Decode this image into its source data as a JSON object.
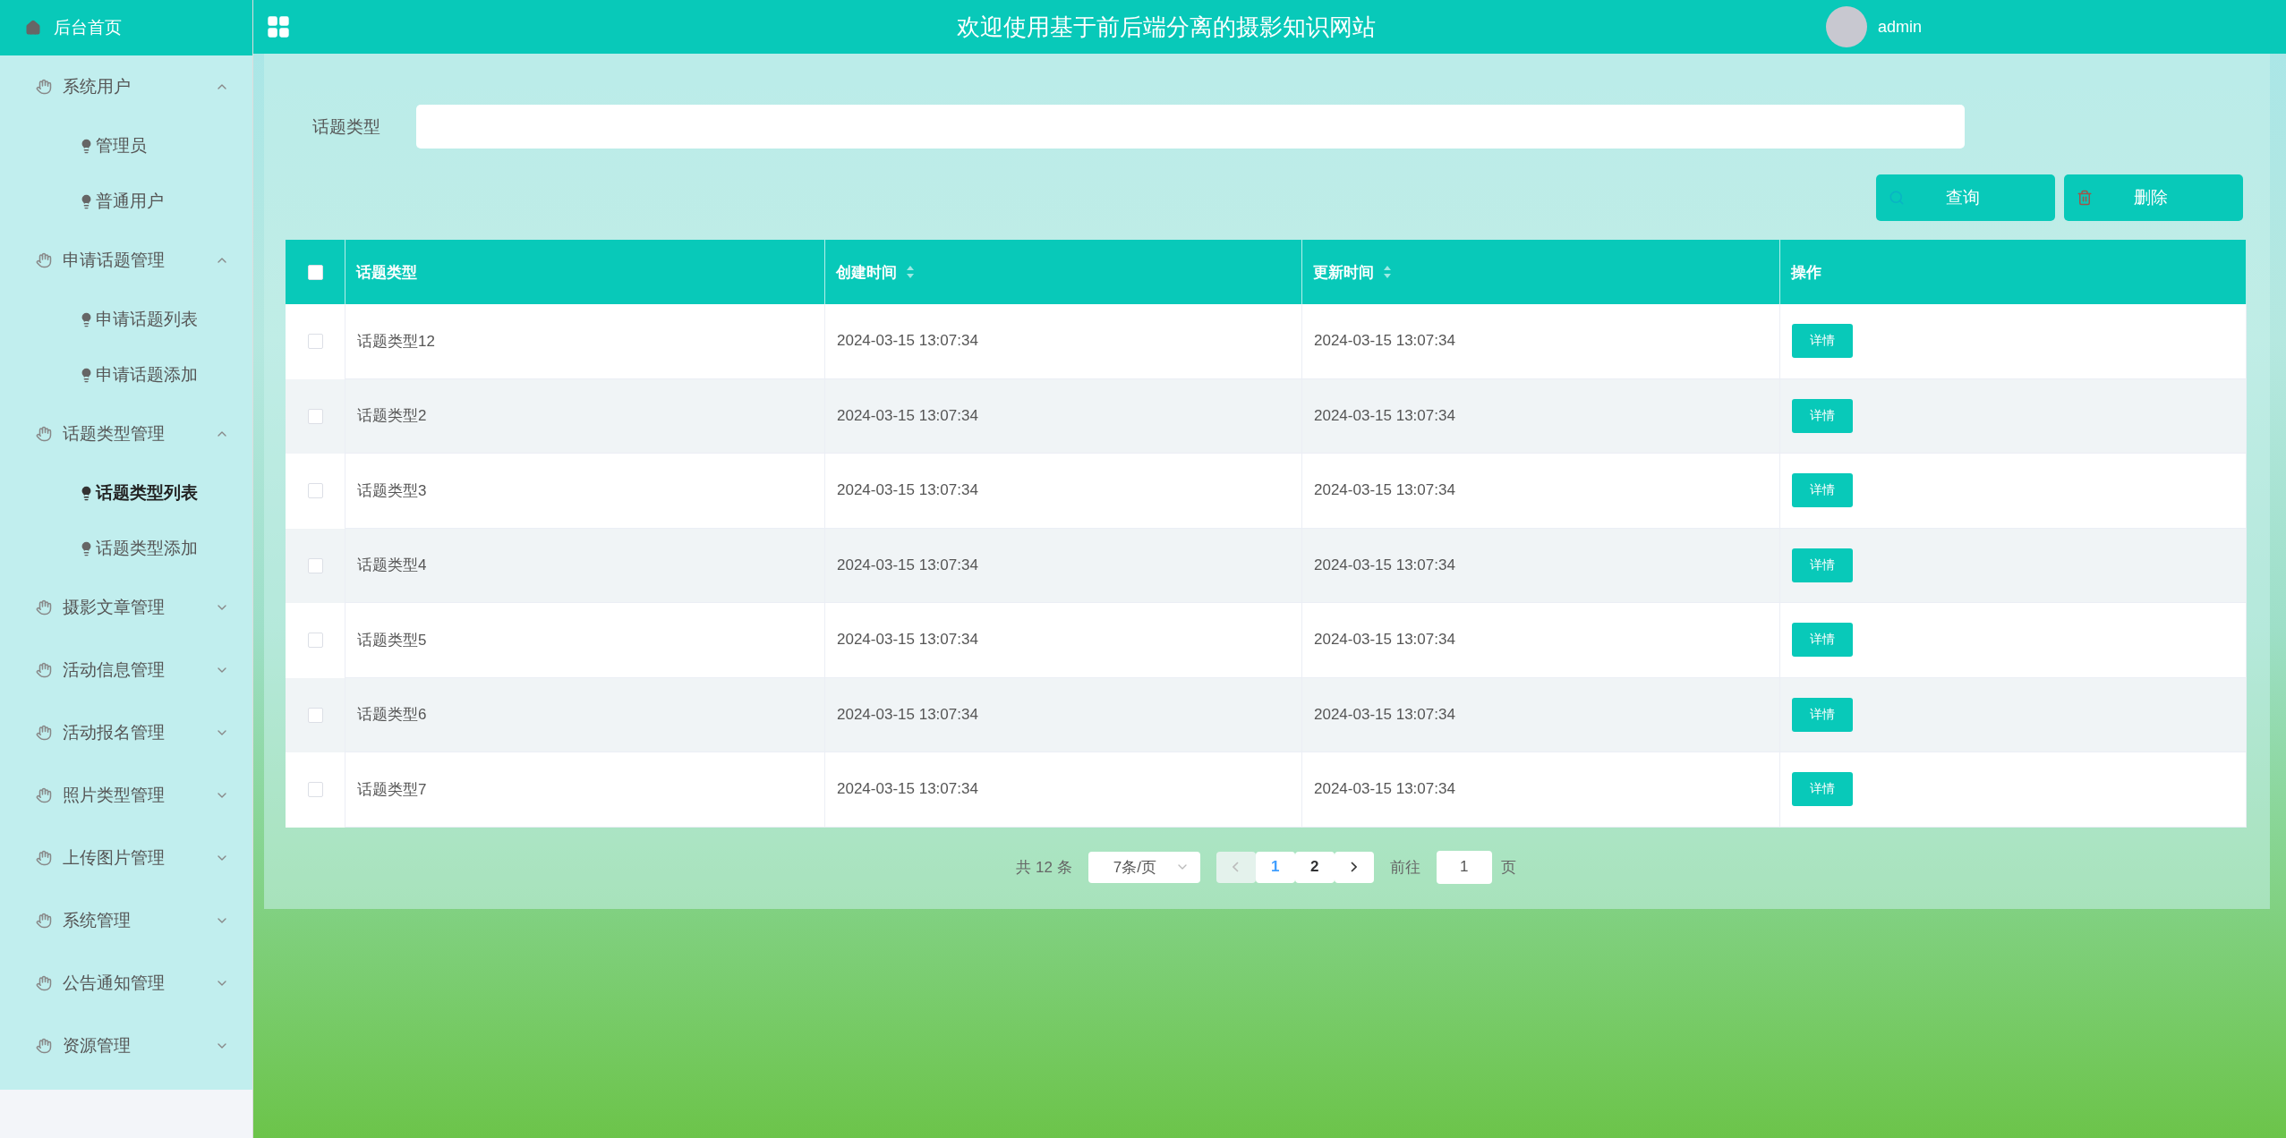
{
  "header": {
    "title": "欢迎使用基于前后端分离的摄影知识网站",
    "user": "admin"
  },
  "sidebar": {
    "home": "后台首页",
    "groups": [
      {
        "label": "系统用户",
        "expanded": true,
        "children": [
          {
            "label": "管理员",
            "selected": false
          },
          {
            "label": "普通用户",
            "selected": false
          }
        ]
      },
      {
        "label": "申请话题管理",
        "expanded": true,
        "children": [
          {
            "label": "申请话题列表",
            "selected": false
          },
          {
            "label": "申请话题添加",
            "selected": false
          }
        ]
      },
      {
        "label": "话题类型管理",
        "expanded": true,
        "children": [
          {
            "label": "话题类型列表",
            "selected": true
          },
          {
            "label": "话题类型添加",
            "selected": false
          }
        ]
      },
      {
        "label": "摄影文章管理",
        "expanded": false
      },
      {
        "label": "活动信息管理",
        "expanded": false
      },
      {
        "label": "活动报名管理",
        "expanded": false
      },
      {
        "label": "照片类型管理",
        "expanded": false
      },
      {
        "label": "上传图片管理",
        "expanded": false
      },
      {
        "label": "系统管理",
        "expanded": false
      },
      {
        "label": "公告通知管理",
        "expanded": false
      },
      {
        "label": "资源管理",
        "expanded": false
      }
    ]
  },
  "search": {
    "label": "话题类型",
    "buttons": [
      {
        "label": "查询",
        "kind": "search"
      },
      {
        "label": "删除",
        "kind": "delete"
      }
    ]
  },
  "table": {
    "header_checked": false,
    "columns": [
      {
        "label": "话题类型",
        "sortable": false
      },
      {
        "label": "创建时间",
        "sortable": true
      },
      {
        "label": "更新时间",
        "sortable": true
      },
      {
        "label": "操作",
        "sortable": false
      }
    ],
    "rows": [
      {
        "checked": false,
        "cells": [
          "话题类型12",
          "2024-03-15 13:07:34",
          "2024-03-15 13:07:34"
        ],
        "action": "详情"
      },
      {
        "checked": false,
        "cells": [
          "话题类型2",
          "2024-03-15 13:07:34",
          "2024-03-15 13:07:34"
        ],
        "action": "详情"
      },
      {
        "checked": false,
        "cells": [
          "话题类型3",
          "2024-03-15 13:07:34",
          "2024-03-15 13:07:34"
        ],
        "action": "详情"
      },
      {
        "checked": false,
        "cells": [
          "话题类型4",
          "2024-03-15 13:07:34",
          "2024-03-15 13:07:34"
        ],
        "action": "详情"
      },
      {
        "checked": false,
        "cells": [
          "话题类型5",
          "2024-03-15 13:07:34",
          "2024-03-15 13:07:34"
        ],
        "action": "详情"
      },
      {
        "checked": false,
        "cells": [
          "话题类型6",
          "2024-03-15 13:07:34",
          "2024-03-15 13:07:34"
        ],
        "action": "详情"
      },
      {
        "checked": false,
        "cells": [
          "话题类型7",
          "2024-03-15 13:07:34",
          "2024-03-15 13:07:34"
        ],
        "action": "详情"
      }
    ]
  },
  "pagination": {
    "total": "共 12 条",
    "page_size": "7条/页",
    "prev_disabled": true,
    "pages": [
      {
        "label": "1",
        "selected": true
      },
      {
        "label": "2",
        "selected": false
      }
    ],
    "goto_label": "前往",
    "goto_value": "1",
    "goto_suffix": "页"
  }
}
